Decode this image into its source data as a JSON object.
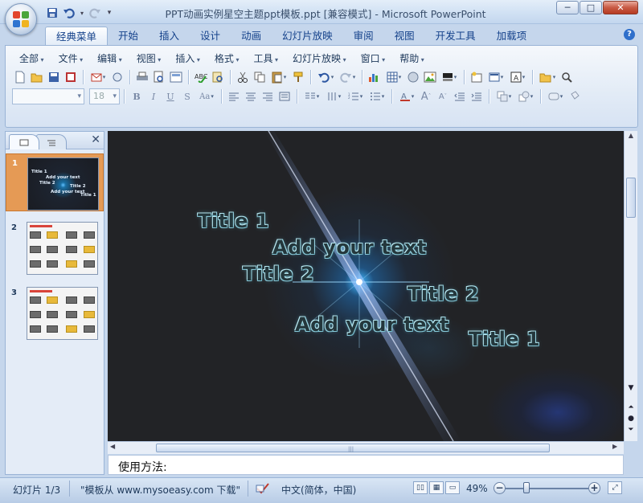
{
  "window": {
    "title": "PPT动画实例星空主题ppt模板.ppt [兼容模式] - Microsoft PowerPoint",
    "controls": {
      "minimize": "─",
      "maximize": "□",
      "close": "✕"
    }
  },
  "ribbon": {
    "tabs": [
      "经典菜单",
      "开始",
      "插入",
      "设计",
      "动画",
      "幻灯片放映",
      "审阅",
      "视图",
      "开发工具",
      "加载项"
    ],
    "active_tab": "经典菜单",
    "help": "?",
    "menus": [
      "全部",
      "文件",
      "编辑",
      "视图",
      "插入",
      "格式",
      "工具",
      "幻灯片放映",
      "窗口",
      "帮助"
    ],
    "font_size": "18"
  },
  "slide_panel": {
    "slides": [
      {
        "number": "1",
        "labels": [
          "Title 1",
          "Add your text",
          "Title 2",
          "Title 2",
          "Add your text",
          "Title 1"
        ]
      },
      {
        "number": "2"
      },
      {
        "number": "3"
      }
    ]
  },
  "slide": {
    "texts": [
      "Title 1",
      "Add your text",
      "Title 2",
      "Title 2",
      "Add your text",
      "Title 1"
    ]
  },
  "notes": {
    "text": "使用方法:"
  },
  "status": {
    "slide_info": "幻灯片 1/3",
    "theme": "\"模板从 www.mysoeasy.com 下载\"",
    "language": "中文(简体，中国)",
    "zoom": "49%"
  },
  "colors": {
    "accent": "#15428b",
    "selected_thumb": "#e59a55",
    "slide_bg": "#222326",
    "star_glow": "#3caaf0"
  },
  "icons": [
    "office-button",
    "save-icon",
    "undo-icon",
    "redo-icon",
    "help-icon"
  ]
}
